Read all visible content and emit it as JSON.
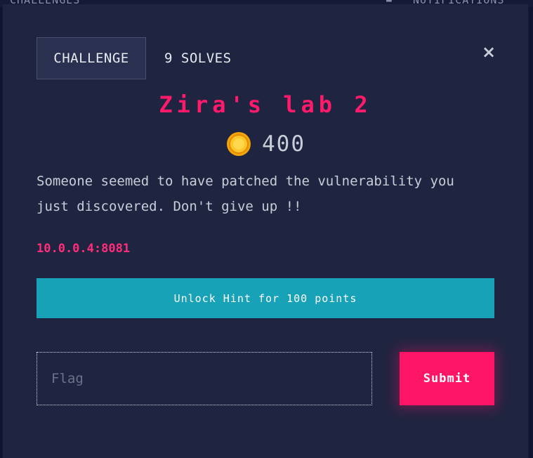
{
  "backdrop": {
    "left_label": "CHALLENGES",
    "right_label": "NOTIFICATIONS"
  },
  "modal": {
    "tabs": {
      "challenge_label": "CHALLENGE",
      "solves_label": "9 SOLVES"
    },
    "close_symbol": "×",
    "title": "Zira's lab 2",
    "points": "400",
    "coin_icon": "coin-icon",
    "description": "Someone seemed to have patched the vulnerability you just discovered. Don't give up !!",
    "address": "10.0.0.4:8081",
    "hint_button_label": "Unlock Hint for 100 points",
    "flag_placeholder": "Flag",
    "submit_label": "Submit"
  },
  "colors": {
    "title": "#ff1a6b",
    "accent_pink": "#ff1466",
    "hint_teal": "#17a2b8",
    "modal_bg": "#1f2540"
  }
}
